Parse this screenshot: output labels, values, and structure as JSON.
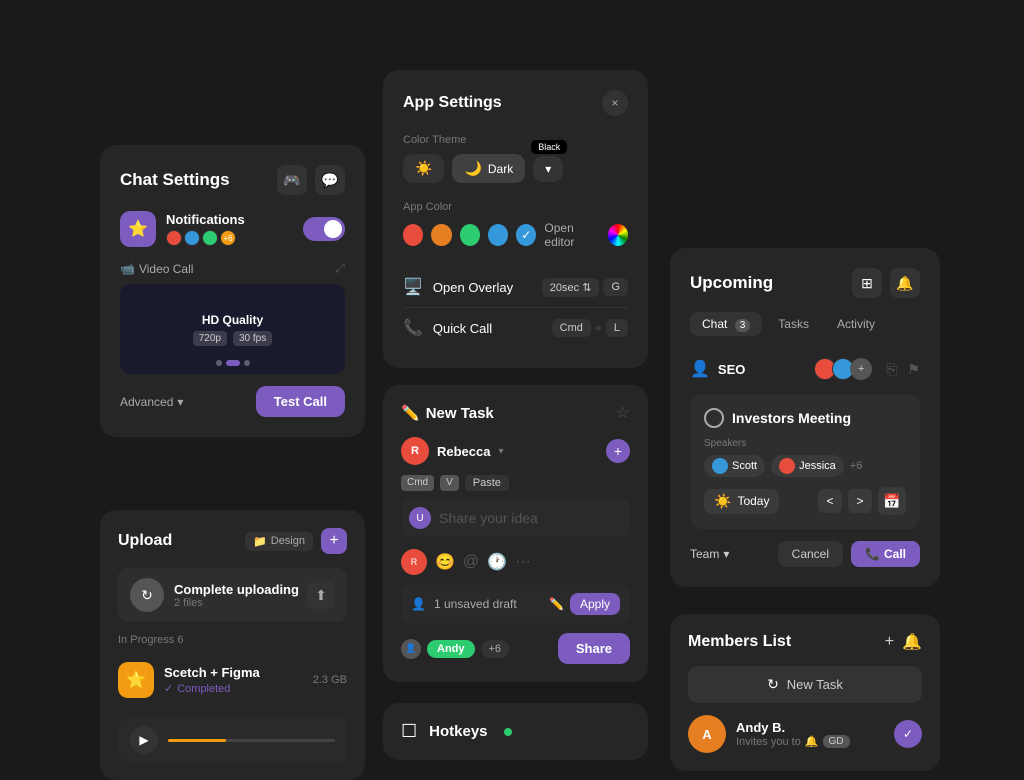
{
  "chatSettings": {
    "title": "Chat Settings",
    "icons": [
      "🎮",
      "💬"
    ],
    "notifications": {
      "label": "Notifications",
      "avatarIcon": "⭐",
      "toggle": true
    },
    "videoCall": {
      "label": "Video Call",
      "quality": "HD Quality",
      "resolution": "720p",
      "fps": "30 fps"
    },
    "advanced": "Advanced",
    "testCallBtn": "Test Call"
  },
  "upload": {
    "title": "Upload",
    "designBadge": "Design",
    "complete": {
      "name": "Complete uploading",
      "count": "2 files"
    },
    "inProgress": "In Progress",
    "inProgressCount": "6",
    "file": {
      "name": "Scetch + Figma",
      "status": "Completed",
      "size": "2.3 GB"
    }
  },
  "appSettings": {
    "title": "App Settings",
    "closeIcon": "×",
    "colorTheme": "Color Theme",
    "darkOption": "Dark",
    "blackBadge": "Black",
    "appColor": "App Color",
    "openEditor": "Open editor",
    "openOverlay": "Open Overlay",
    "overlayTime": "20sec",
    "overlayKey": "G",
    "quickCall": "Quick Call",
    "quickCallKey1": "Cmd",
    "quickCallKey2": "L"
  },
  "newTask": {
    "title": "New Task",
    "assignee": "Rebecca",
    "pasteBadges": [
      "Cmd",
      "V"
    ],
    "pasteLabel": "Paste",
    "placeholder": "Share your idea",
    "draft": "1 unsaved draft",
    "applyBtn": "Apply",
    "andyBadge": "Andy",
    "plusN": "+6",
    "shareBtn": "Share"
  },
  "hotkeys": {
    "title": "Hotkeys"
  },
  "upcoming": {
    "title": "Upcoming",
    "tabs": [
      {
        "label": "Chat",
        "badge": "3",
        "active": true
      },
      {
        "label": "Tasks",
        "active": false
      },
      {
        "label": "Activity",
        "active": false
      }
    ],
    "seo": {
      "label": "SEO",
      "plusLabel": "+"
    },
    "meeting": {
      "name": "Investors Meeting",
      "speakersLabel": "Speakers",
      "speakers": [
        "Scott",
        "Jessica"
      ],
      "plusN": "+6",
      "date": "Today"
    },
    "teamBtn": "Team",
    "cancelBtn": "Cancel",
    "callBtn": "Call"
  },
  "members": {
    "title": "Members List",
    "newTaskBtn": "New Task",
    "member": {
      "name": "Andy B.",
      "invite": "Invites you to",
      "badge": "GD"
    }
  }
}
